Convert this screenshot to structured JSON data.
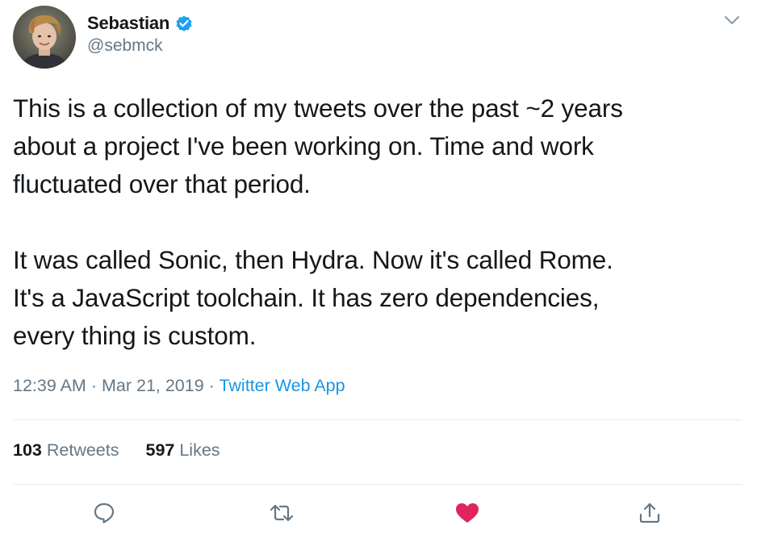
{
  "author": {
    "name": "Sebastian",
    "handle": "@sebmck",
    "verified": true,
    "avatar_icon": "user-avatar-photo"
  },
  "tweet": {
    "text": "This is a collection of my tweets over the past ~2 years\nabout a project I've been working on. Time and work\nfluctuated over that period.\n\nIt was called Sonic, then Hydra. Now it's called Rome.\nIt's a JavaScript toolchain. It has zero dependencies,\nevery thing is custom.",
    "time": "12:39 AM",
    "date": "Mar 21, 2019",
    "separator": "·",
    "source": "Twitter Web App"
  },
  "stats": {
    "retweets_count": "103",
    "retweets_label": "Retweets",
    "likes_count": "597",
    "likes_label": "Likes"
  },
  "actions": [
    {
      "name": "reply-icon"
    },
    {
      "name": "retweet-icon"
    },
    {
      "name": "like-icon",
      "active": true
    },
    {
      "name": "share-icon"
    }
  ],
  "colors": {
    "text_primary": "#14171a",
    "text_secondary": "#657786",
    "link": "#1b95e0",
    "verified_badge": "#1da1f2",
    "like_active": "#e0245e",
    "divider": "#e6ecf0"
  }
}
